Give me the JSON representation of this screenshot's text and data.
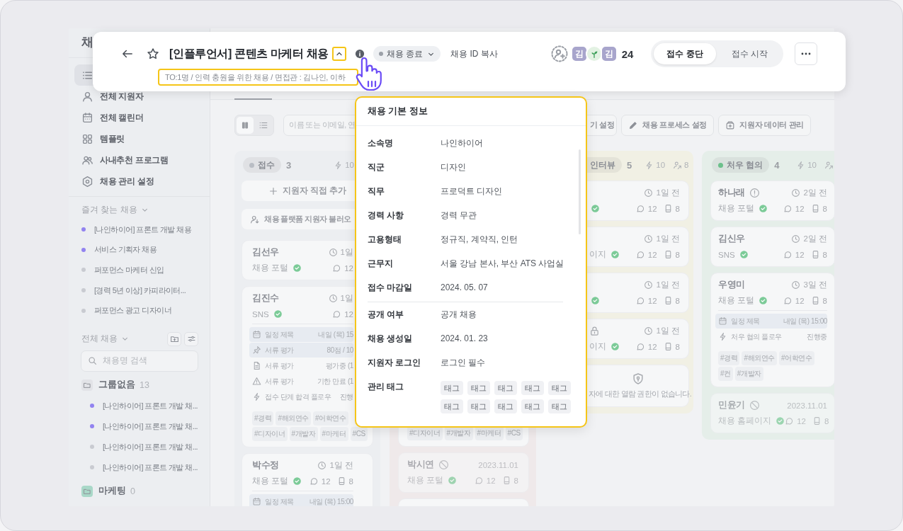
{
  "sidebar": {
    "title": "채",
    "nav": [
      {
        "selected": true
      },
      {
        "label": "전체 지원자",
        "selected": false
      },
      {
        "label": "전체 캘린더",
        "selected": false
      },
      {
        "label": "템플릿",
        "selected": false
      },
      {
        "label": "사내추천 프로그램",
        "selected": false
      },
      {
        "label": "채용 관리 설정",
        "selected": false
      }
    ],
    "favorites_title": "즐겨 찾는 채용",
    "favorites": [
      {
        "label": "[나인하이어] 프론트 개발 채용",
        "color": "#9283f0"
      },
      {
        "label": "서비스 기획자 채용",
        "color": "#9283f0"
      },
      {
        "label": "퍼포먼스 마케터 신입",
        "color": "#c9cbd1"
      },
      {
        "label": "[경력 5년 이상] 카피라이터...",
        "color": "#c9cbd1"
      },
      {
        "label": "퍼포먼스 광고 디자이너",
        "color": "#c9cbd1"
      }
    ],
    "all_title": "전체 채용",
    "search": {
      "placeholder": "채용명 검색"
    },
    "groups": [
      {
        "name": "그룹없음",
        "count": "13",
        "color": "#e2e3e7",
        "items": [
          {
            "label": "[나인하이어] 프론트 개발 채...",
            "color": "#9283f0"
          },
          {
            "label": "[나인하이어] 프론트 개발 채...",
            "color": "#9283f0"
          },
          {
            "label": "[나인하이어] 프론트 개발 채...",
            "color": "#c9cbd1"
          },
          {
            "label": "[나인하이어] 프론트 개발 채...",
            "color": "#c9cbd1"
          }
        ]
      },
      {
        "name": "마케팅",
        "count": "0",
        "color": "#a9d8c8"
      }
    ]
  },
  "header": {
    "title": "[인플루언서] 콘텐츠 마케터 채용",
    "status": "채용 종료",
    "copy_label": "채용 ID 복사",
    "subtitle": "TO:1명 / 인력 충원을 위한 채용 / 면접관 : 김나인, 이하",
    "avatars": [
      {
        "kind": "letter",
        "text": "김"
      },
      {
        "kind": "sprout"
      },
      {
        "kind": "letter",
        "text": "김"
      }
    ],
    "member_count": "24",
    "segments": [
      {
        "label": "접수 중단",
        "selected": true
      },
      {
        "label": "접수 시작",
        "selected": false
      }
    ]
  },
  "toolbar": {
    "views": [
      {
        "kind": "board",
        "selected": true
      },
      {
        "kind": "list",
        "selected": false
      }
    ],
    "search": {
      "placeholder": "이름 또는 이메일, 연"
    },
    "buttons": [
      {
        "kind": "plain",
        "label": "기 설정"
      },
      {
        "kind": "pencil",
        "label": "채용 프로세스 설정"
      },
      {
        "kind": "archive",
        "label": "지원자 데이터 관리"
      }
    ]
  },
  "board": {
    "columns": [
      {
        "stage": "접수",
        "count": "3",
        "color": "#b9bdc4",
        "stats": [
          {
            "kind": "bolt",
            "value": "10"
          }
        ],
        "actions": [
          {
            "kind": "plus",
            "label": "지원자 직접 추가"
          },
          {
            "kind": "import",
            "label": "채용 플랫폼 지원자 불러오"
          }
        ],
        "cards": [
          {
            "kind": "applicant",
            "name": "김선우",
            "time": "1일",
            "source": "채용 포털",
            "verified": true,
            "comments": "12",
            "muted": false
          },
          {
            "kind": "applicant",
            "name": "김진수",
            "time": "1일",
            "source": "SNS",
            "verified": true,
            "comments": "12",
            "muted": false,
            "rows": [
              {
                "kind": "calendar",
                "label": "일정 제목",
                "value": "내일 (목) 15",
                "highlight": true
              },
              {
                "kind": "pin",
                "label": "서류 평가",
                "value": "80점 / 10",
                "highlight": true
              },
              {
                "kind": "doc",
                "label": "서류 평가",
                "value": "평가중 (1",
                "highlight": false
              },
              {
                "kind": "warning",
                "label": "서류 평가",
                "value": "기한 만료 (1",
                "highlight": false
              },
              {
                "kind": "flow",
                "label": "접수 단계 합격 플로우",
                "value": "진행",
                "highlight": false
              }
            ],
            "tags": [
              "#경력",
              "#해외연수",
              "#어학연수",
              "#디자이너",
              "#개발자",
              "#마케터",
              "#CS"
            ]
          },
          {
            "kind": "applicant",
            "name": "박수정",
            "time": "1일 전",
            "source": "채용 포털",
            "verified": true,
            "comments": "12",
            "docs": "8",
            "muted": false,
            "rows": [
              {
                "kind": "calendar",
                "label": "일정 제목",
                "value": "내일 (목) 15:00",
                "highlight": true
              }
            ]
          }
        ]
      },
      {
        "cards": [
          {
            "kind": "tail",
            "tags": [
              "#디자이너",
              "#개발자",
              "#마케터",
              "#CS"
            ]
          },
          {
            "kind": "applicant",
            "name": "박시연",
            "name_icon": {
              "kind": "blocked"
            },
            "date": "2023.11.01",
            "source": "채용 포털",
            "verified": true,
            "comments": "12",
            "docs": "8",
            "muted": true
          },
          {
            "kind": "stub"
          }
        ]
      },
      {
        "stage": "인터뷰",
        "count": "5",
        "stats": [
          {
            "kind": "bolt",
            "value": "10"
          },
          {
            "kind": "person",
            "value": "8"
          }
        ],
        "cards": [
          {
            "kind": "applicant",
            "time": "1일 전",
            "verified": true,
            "comments": "12",
            "docs": "8",
            "muted": false
          },
          {
            "kind": "applicant",
            "time": "1일 전",
            "source": "이지",
            "verified": true,
            "comments": "12",
            "docs": "8",
            "muted": false
          },
          {
            "kind": "applicant",
            "time": "1일 전",
            "verified": true,
            "comments": "12",
            "docs": "8",
            "muted": false
          },
          {
            "kind": "applicant",
            "name_icon": {
              "kind": "lock"
            },
            "time": "1일 전",
            "source": "이지",
            "verified": true,
            "comments": "12",
            "docs": "8",
            "muted": false
          },
          {
            "kind": "restricted",
            "message": "자에 대한 열람 권한이 없습니다."
          }
        ]
      },
      {
        "stage": "처우 협의",
        "count": "4",
        "color": "#6cc08b",
        "stats": [
          {
            "kind": "bolt",
            "value": "10"
          },
          {
            "kind": "person"
          }
        ],
        "cards": [
          {
            "kind": "applicant",
            "name": "하나래",
            "name_icon": {
              "kind": "info"
            },
            "time": "2일 전",
            "source": "채용 포털",
            "verified": true,
            "comments": "12",
            "docs": "8",
            "muted": false
          },
          {
            "kind": "applicant",
            "name": "김신우",
            "time": "2일 전",
            "source": "SNS",
            "verified": true,
            "comments": "12",
            "docs": "8",
            "muted": false
          },
          {
            "kind": "applicant",
            "name": "우영미",
            "time": "3일 전",
            "source": "채용 포털",
            "verified": true,
            "comments": "12",
            "docs": "8",
            "muted": false,
            "rows": [
              {
                "kind": "calendar",
                "label": "일정 제목",
                "value": "내일 (목) 15:00",
                "highlight": true
              },
              {
                "kind": "flow",
                "label": "처우 협의 플로우",
                "value": "진행중",
                "highlight": false
              }
            ],
            "tags": [
              "#경력",
              "#해외연수",
              "#어학연수",
              "#컨",
              "#개발자"
            ]
          },
          {
            "kind": "applicant",
            "name": "민윤기",
            "name_icon": {
              "kind": "blocked"
            },
            "date": "2023.11.01",
            "source": "채용 홈페이지",
            "verified": true,
            "comments": "12",
            "docs": "8",
            "muted": true
          }
        ]
      }
    ]
  },
  "popup": {
    "title": "채용 기본 정보",
    "sections": [
      {
        "rows": [
          {
            "kind": "text",
            "label": "소속명",
            "value": "나인하이어"
          },
          {
            "kind": "text",
            "label": "직군",
            "value": "디자인"
          },
          {
            "kind": "text",
            "label": "직무",
            "value": "프로덕트 디자인"
          },
          {
            "kind": "text",
            "label": "경력 사항",
            "value": "경력 무관"
          },
          {
            "kind": "text",
            "label": "고용형태",
            "value": "정규직, 계약직, 인턴"
          },
          {
            "kind": "text",
            "label": "근무지",
            "value": "서울 강남 본사, 부산 ATS 사업실"
          },
          {
            "kind": "text",
            "label": "접수 마감일",
            "value": "2024. 05. 07"
          }
        ]
      },
      {
        "rows": [
          {
            "kind": "text",
            "label": "공개 여부",
            "value": "공개 채용"
          },
          {
            "kind": "text",
            "label": "채용 생성일",
            "value": "2024. 01. 23"
          },
          {
            "kind": "text",
            "label": "지원자 로그인",
            "value": "로그인 필수"
          },
          {
            "kind": "tags",
            "label": "관리 태그",
            "tags": [
              "태그",
              "태그",
              "태그",
              "태그",
              "태그",
              "태그",
              "태그",
              "태그",
              "태그",
              "태그"
            ]
          }
        ]
      }
    ]
  }
}
